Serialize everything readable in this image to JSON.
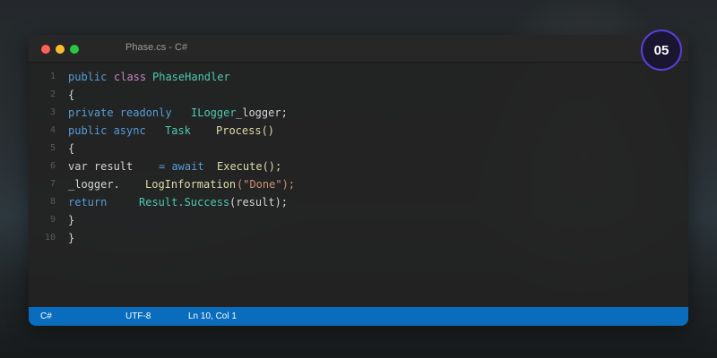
{
  "window": {
    "title": "Phase.cs - C#"
  },
  "badge": "05",
  "colors": {
    "close": "#ff5f57",
    "minimize": "#febc2e",
    "maximize": "#28c840",
    "keyword": "#569cd6",
    "keyword2": "#c586c0",
    "type": "#4ec9b0",
    "method": "#dcdcaa",
    "string": "#ce9178",
    "text": "#d4d4d4",
    "status": "#0a6cbd",
    "badge_ring": "#5b3fd8"
  },
  "code_lines": [
    {
      "n": "1",
      "tokens": [
        {
          "t": "public",
          "c": "keyword"
        },
        {
          "t": "class",
          "c": "keyword2"
        },
        {
          "t": "PhaseHandler",
          "c": "type"
        }
      ]
    },
    {
      "n": "2",
      "tokens": [
        {
          "t": "{",
          "c": "text"
        }
      ]
    },
    {
      "n": "3",
      "tokens": [
        {
          "t": "private readonly",
          "c": "keyword"
        },
        {
          "t": "ILogger",
          "c": "type"
        },
        {
          "t": "_logger;",
          "c": "text"
        }
      ]
    },
    {
      "n": "4",
      "tokens": [
        {
          "t": "public async",
          "c": "keyword"
        },
        {
          "t": "Task",
          "c": "type"
        },
        {
          "t": "Process()",
          "c": "method"
        }
      ]
    },
    {
      "n": "5",
      "tokens": [
        {
          "t": "{",
          "c": "text"
        }
      ]
    },
    {
      "n": "6",
      "tokens": [
        {
          "t": "var result",
          "c": "text"
        },
        {
          "t": "= await",
          "c": "keyword"
        },
        {
          "t": "Execute();",
          "c": "method"
        }
      ]
    },
    {
      "n": "7",
      "tokens": [
        {
          "t": "_logger.",
          "c": "text"
        },
        {
          "t": "LogInformation",
          "c": "method"
        },
        {
          "t": "(\"Done\");",
          "c": "string"
        }
      ]
    },
    {
      "n": "8",
      "tokens": [
        {
          "t": "return",
          "c": "keyword"
        },
        {
          "t": "Result.Success",
          "c": "type"
        },
        {
          "t": "(result);",
          "c": "text"
        }
      ]
    },
    {
      "n": "9",
      "tokens": [
        {
          "t": "}",
          "c": "text"
        }
      ]
    },
    {
      "n": "10",
      "tokens": [
        {
          "t": "}",
          "c": "text"
        }
      ]
    }
  ],
  "statusbar": {
    "language": "C#",
    "encoding": "UTF-8",
    "position": "Ln 10, Col 1"
  }
}
